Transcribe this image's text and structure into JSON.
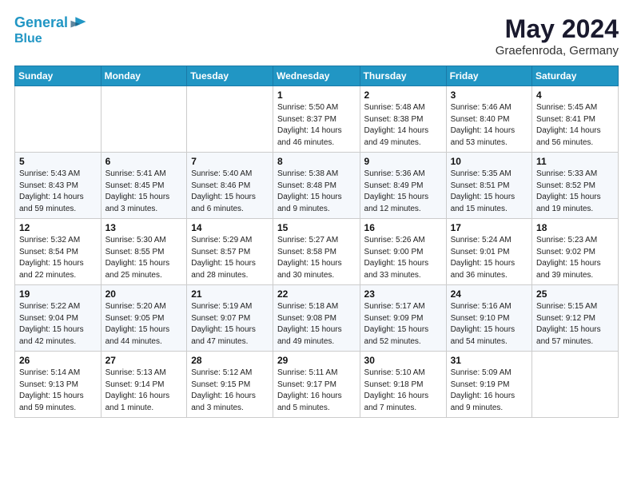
{
  "header": {
    "logo_line1": "General",
    "logo_line2": "Blue",
    "month_year": "May 2024",
    "location": "Graefenroda, Germany"
  },
  "days_of_week": [
    "Sunday",
    "Monday",
    "Tuesday",
    "Wednesday",
    "Thursday",
    "Friday",
    "Saturday"
  ],
  "weeks": [
    [
      {
        "day": "",
        "info": ""
      },
      {
        "day": "",
        "info": ""
      },
      {
        "day": "",
        "info": ""
      },
      {
        "day": "1",
        "info": "Sunrise: 5:50 AM\nSunset: 8:37 PM\nDaylight: 14 hours\nand 46 minutes."
      },
      {
        "day": "2",
        "info": "Sunrise: 5:48 AM\nSunset: 8:38 PM\nDaylight: 14 hours\nand 49 minutes."
      },
      {
        "day": "3",
        "info": "Sunrise: 5:46 AM\nSunset: 8:40 PM\nDaylight: 14 hours\nand 53 minutes."
      },
      {
        "day": "4",
        "info": "Sunrise: 5:45 AM\nSunset: 8:41 PM\nDaylight: 14 hours\nand 56 minutes."
      }
    ],
    [
      {
        "day": "5",
        "info": "Sunrise: 5:43 AM\nSunset: 8:43 PM\nDaylight: 14 hours\nand 59 minutes."
      },
      {
        "day": "6",
        "info": "Sunrise: 5:41 AM\nSunset: 8:45 PM\nDaylight: 15 hours\nand 3 minutes."
      },
      {
        "day": "7",
        "info": "Sunrise: 5:40 AM\nSunset: 8:46 PM\nDaylight: 15 hours\nand 6 minutes."
      },
      {
        "day": "8",
        "info": "Sunrise: 5:38 AM\nSunset: 8:48 PM\nDaylight: 15 hours\nand 9 minutes."
      },
      {
        "day": "9",
        "info": "Sunrise: 5:36 AM\nSunset: 8:49 PM\nDaylight: 15 hours\nand 12 minutes."
      },
      {
        "day": "10",
        "info": "Sunrise: 5:35 AM\nSunset: 8:51 PM\nDaylight: 15 hours\nand 15 minutes."
      },
      {
        "day": "11",
        "info": "Sunrise: 5:33 AM\nSunset: 8:52 PM\nDaylight: 15 hours\nand 19 minutes."
      }
    ],
    [
      {
        "day": "12",
        "info": "Sunrise: 5:32 AM\nSunset: 8:54 PM\nDaylight: 15 hours\nand 22 minutes."
      },
      {
        "day": "13",
        "info": "Sunrise: 5:30 AM\nSunset: 8:55 PM\nDaylight: 15 hours\nand 25 minutes."
      },
      {
        "day": "14",
        "info": "Sunrise: 5:29 AM\nSunset: 8:57 PM\nDaylight: 15 hours\nand 28 minutes."
      },
      {
        "day": "15",
        "info": "Sunrise: 5:27 AM\nSunset: 8:58 PM\nDaylight: 15 hours\nand 30 minutes."
      },
      {
        "day": "16",
        "info": "Sunrise: 5:26 AM\nSunset: 9:00 PM\nDaylight: 15 hours\nand 33 minutes."
      },
      {
        "day": "17",
        "info": "Sunrise: 5:24 AM\nSunset: 9:01 PM\nDaylight: 15 hours\nand 36 minutes."
      },
      {
        "day": "18",
        "info": "Sunrise: 5:23 AM\nSunset: 9:02 PM\nDaylight: 15 hours\nand 39 minutes."
      }
    ],
    [
      {
        "day": "19",
        "info": "Sunrise: 5:22 AM\nSunset: 9:04 PM\nDaylight: 15 hours\nand 42 minutes."
      },
      {
        "day": "20",
        "info": "Sunrise: 5:20 AM\nSunset: 9:05 PM\nDaylight: 15 hours\nand 44 minutes."
      },
      {
        "day": "21",
        "info": "Sunrise: 5:19 AM\nSunset: 9:07 PM\nDaylight: 15 hours\nand 47 minutes."
      },
      {
        "day": "22",
        "info": "Sunrise: 5:18 AM\nSunset: 9:08 PM\nDaylight: 15 hours\nand 49 minutes."
      },
      {
        "day": "23",
        "info": "Sunrise: 5:17 AM\nSunset: 9:09 PM\nDaylight: 15 hours\nand 52 minutes."
      },
      {
        "day": "24",
        "info": "Sunrise: 5:16 AM\nSunset: 9:10 PM\nDaylight: 15 hours\nand 54 minutes."
      },
      {
        "day": "25",
        "info": "Sunrise: 5:15 AM\nSunset: 9:12 PM\nDaylight: 15 hours\nand 57 minutes."
      }
    ],
    [
      {
        "day": "26",
        "info": "Sunrise: 5:14 AM\nSunset: 9:13 PM\nDaylight: 15 hours\nand 59 minutes."
      },
      {
        "day": "27",
        "info": "Sunrise: 5:13 AM\nSunset: 9:14 PM\nDaylight: 16 hours\nand 1 minute."
      },
      {
        "day": "28",
        "info": "Sunrise: 5:12 AM\nSunset: 9:15 PM\nDaylight: 16 hours\nand 3 minutes."
      },
      {
        "day": "29",
        "info": "Sunrise: 5:11 AM\nSunset: 9:17 PM\nDaylight: 16 hours\nand 5 minutes."
      },
      {
        "day": "30",
        "info": "Sunrise: 5:10 AM\nSunset: 9:18 PM\nDaylight: 16 hours\nand 7 minutes."
      },
      {
        "day": "31",
        "info": "Sunrise: 5:09 AM\nSunset: 9:19 PM\nDaylight: 16 hours\nand 9 minutes."
      },
      {
        "day": "",
        "info": ""
      }
    ]
  ]
}
